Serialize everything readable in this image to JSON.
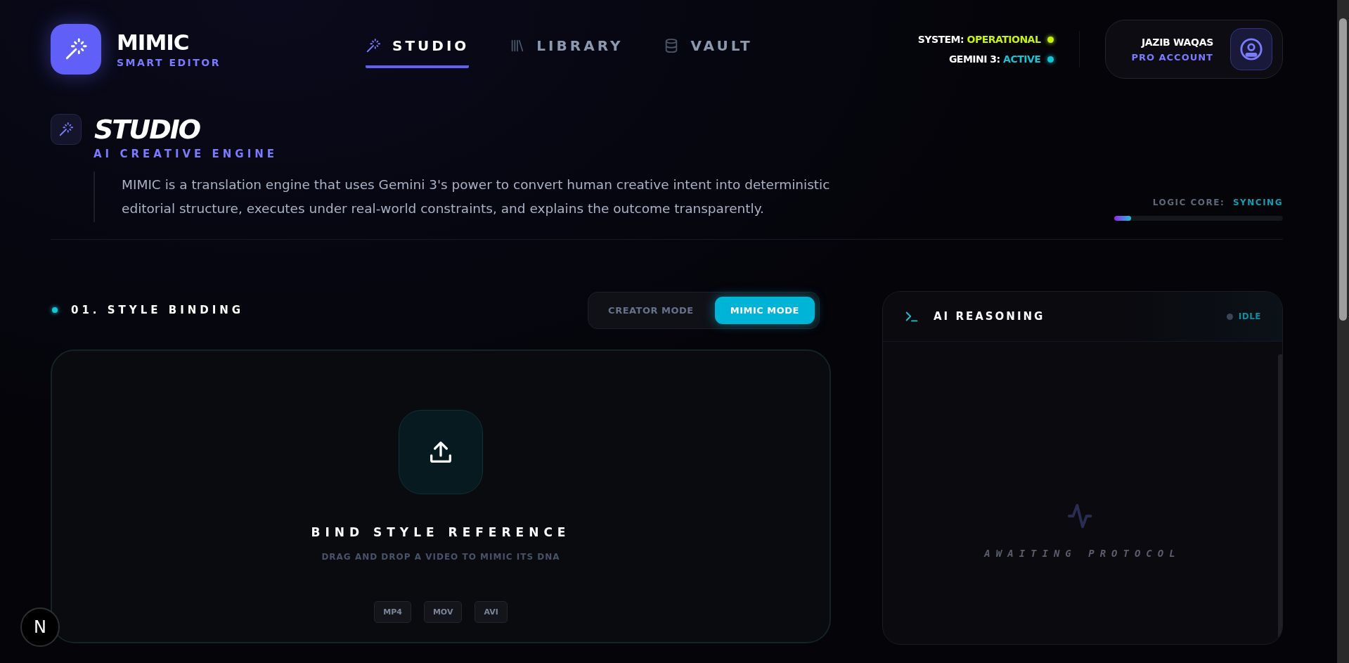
{
  "brand": {
    "title": "MIMIC",
    "subtitle": "SMART EDITOR"
  },
  "nav": [
    {
      "label": "STUDIO",
      "kind": "wand",
      "selected": true
    },
    {
      "label": "LIBRARY",
      "kind": "books",
      "selected": false
    },
    {
      "label": "VAULT",
      "kind": "database",
      "selected": false
    }
  ],
  "status": [
    {
      "label": "SYSTEM:",
      "value": "OPERATIONAL",
      "color": "#c6f10e"
    },
    {
      "label": "GEMINI 3:",
      "value": "ACTIVE",
      "color": "#17c2d3"
    }
  ],
  "account": {
    "name": "JAZIB WAQAS",
    "plan": "PRO ACCOUNT"
  },
  "page": {
    "title": "STUDIO",
    "subtitle": "AI CREATIVE ENGINE",
    "description": "MIMIC is a translation engine that uses Gemini 3's power to convert human creative intent into deterministic editorial structure, executes under real-world constraints, and explains the outcome transparently.",
    "logic_core": {
      "label": "LOGIC CORE:",
      "value": "SYNCING",
      "level": 0.1
    }
  },
  "style_binding": {
    "title": "01. STYLE BINDING",
    "modes": [
      {
        "label": "CREATOR MODE",
        "selected": false
      },
      {
        "label": "MIMIC MODE",
        "selected": true
      }
    ],
    "dropzone": {
      "title": "BIND STYLE REFERENCE",
      "hint": "DRAG AND DROP A VIDEO TO MIMIC ITS DNA",
      "formats": [
        "MP4",
        "MOV",
        "AVI"
      ]
    }
  },
  "reasoning": {
    "title": "AI REASONING",
    "status": "IDLE",
    "empty_text": "AWAITING PROTOCOL"
  },
  "dev_badge": "N"
}
